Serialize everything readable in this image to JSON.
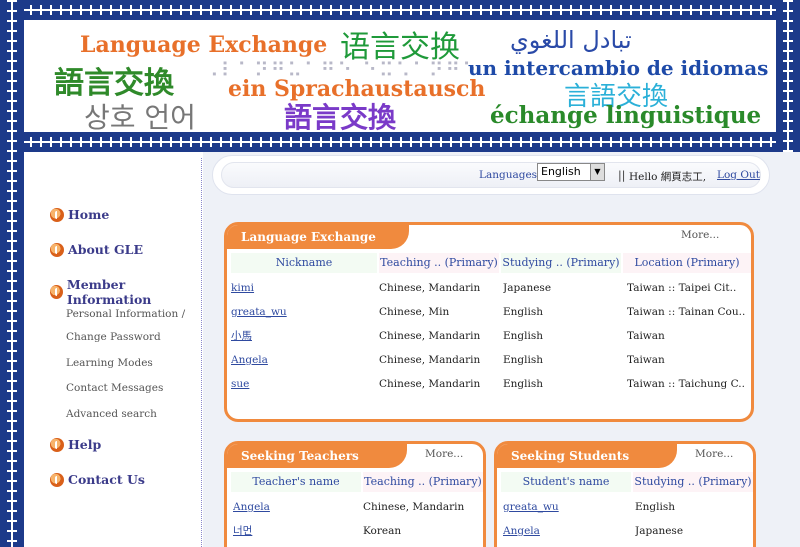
{
  "banner": {
    "english": "Language Exchange",
    "chinese_simplified": "语言交换",
    "arabic": "تبادل اللغوي",
    "chinese_traditional": "語言交換",
    "braille": "⠠⠇⠁⠝⠛⠥⠁⠛⠑ ⠑⠭⠡⠁⠝⠛⠑",
    "spanish": "un intercambio de idiomas",
    "german": "ein Sprachaustausch",
    "korean": "상호 언어",
    "chinese_seal": "語言交換",
    "japanese": "言語交換",
    "french": "échange linguistique"
  },
  "sidebar": {
    "home": "Home",
    "about": "About GLE",
    "member_info": "Member Information",
    "sub": [
      "Personal Information /",
      "Change Password",
      "Learning Modes",
      "Contact Messages",
      "Advanced search"
    ],
    "help": "Help",
    "contact": "Contact Us"
  },
  "lang_bar": {
    "label": "Languages:",
    "selected": "English",
    "separator": "||",
    "hello": "Hello 網頁志工,",
    "logout": "Log Out"
  },
  "exchange": {
    "title": "Language Exchange",
    "more": "More...",
    "headers": [
      "Nickname",
      "Teaching .. (Primary)",
      "Studying .. (Primary)",
      "Location (Primary)"
    ],
    "rows": [
      [
        "kimi",
        "Chinese, Mandarin",
        "Japanese",
        "Taiwan :: Taipei Cit.."
      ],
      [
        "greata_wu",
        "Chinese, Min",
        "English",
        "Taiwan :: Tainan Cou.."
      ],
      [
        "小馬",
        "Chinese, Mandarin",
        "English",
        "Taiwan"
      ],
      [
        "Angela",
        "Chinese, Mandarin",
        "English",
        "Taiwan"
      ],
      [
        "sue",
        "Chinese, Mandarin",
        "English",
        "Taiwan :: Taichung C.."
      ]
    ]
  },
  "teachers": {
    "title": "Seeking Teachers",
    "more": "More...",
    "headers": [
      "Teacher's name",
      "Teaching .. (Primary)"
    ],
    "rows": [
      [
        "Angela",
        "Chinese, Mandarin"
      ],
      [
        "너먼",
        "Korean"
      ]
    ]
  },
  "students": {
    "title": "Seeking Students",
    "more": "More...",
    "headers": [
      "Student's name",
      "Studying .. (Primary)"
    ],
    "rows": [
      [
        "greata_wu",
        "English"
      ],
      [
        "Angela",
        "Japanese"
      ]
    ]
  }
}
